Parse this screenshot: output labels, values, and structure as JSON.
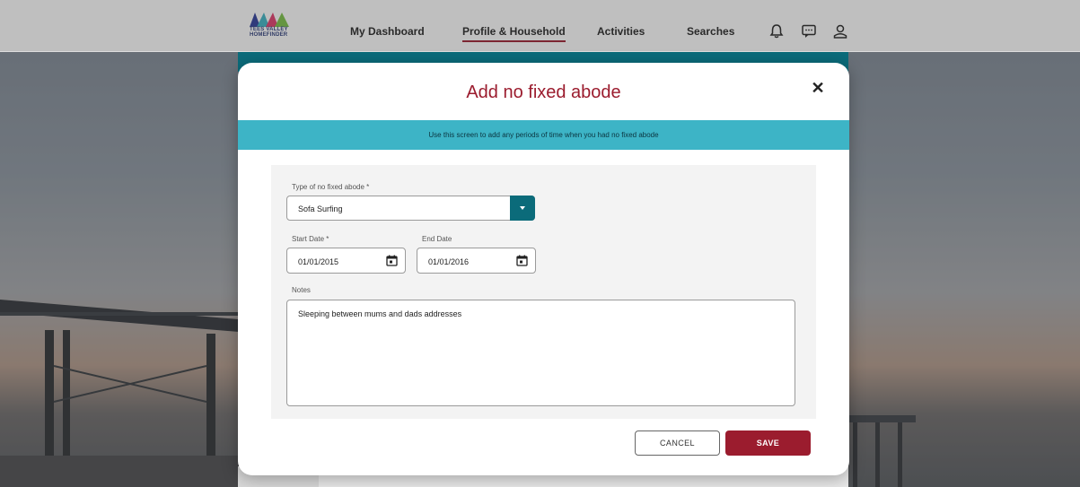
{
  "header": {
    "logo_text_line1": "TEES VALLEY",
    "logo_text_line2": "HOMEFINDER",
    "nav": [
      {
        "label": "My Dashboard"
      },
      {
        "label": "Profile & Household",
        "active": true
      },
      {
        "label": "Activities"
      },
      {
        "label": "Searches"
      }
    ],
    "icons": [
      "bell-icon",
      "chat-icon",
      "user-icon"
    ],
    "accent_color": "#9b1c2e"
  },
  "modal": {
    "title": "Add no fixed abode",
    "info": "Use this screen to add any periods of time when you had no fixed abode",
    "type_label": "Type of no fixed abode *",
    "type_value": "Sofa Surfing",
    "start_label": "Start Date *",
    "start_value": "01/01/2015",
    "end_label": "End Date",
    "end_value": "01/01/2016",
    "notes_label": "Notes",
    "notes_value": "Sleeping between mums and dads addresses",
    "cancel_label": "CANCEL",
    "save_label": "SAVE",
    "banner_color": "#3db4c6",
    "select_button_color": "#0b6b7a"
  }
}
